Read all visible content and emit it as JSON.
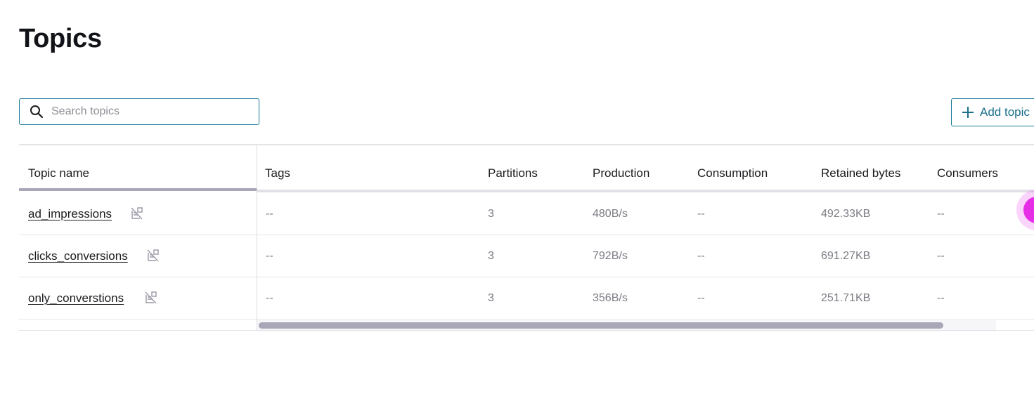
{
  "page": {
    "title": "Topics"
  },
  "search": {
    "placeholder": "Search topics",
    "value": "",
    "icon": "search-icon"
  },
  "toolbar": {
    "add_topic_label": "Add topic",
    "add_icon": "plus-icon"
  },
  "table": {
    "columns": [
      "Topic name",
      "Tags",
      "Partitions",
      "Production",
      "Consumption",
      "Retained bytes",
      "Consumers"
    ],
    "rows": [
      {
        "name": "ad_impressions",
        "tags": "--",
        "partitions": "3",
        "production": "480B/s",
        "consumption": "--",
        "retained_bytes": "492.33KB",
        "consumers": "--"
      },
      {
        "name": "clicks_conversions",
        "tags": "--",
        "partitions": "3",
        "production": "792B/s",
        "consumption": "--",
        "retained_bytes": "691.27KB",
        "consumers": "--"
      },
      {
        "name": "only_converstions",
        "tags": "--",
        "partitions": "3",
        "production": "356B/s",
        "consumption": "--",
        "retained_bytes": "251.71KB",
        "consumers": "--"
      }
    ],
    "row_icon": "no-schema-icon"
  },
  "colors": {
    "accent": "#1a6f8c",
    "scrollbar": "#a9a6b8",
    "fab": "#e62ee6"
  }
}
